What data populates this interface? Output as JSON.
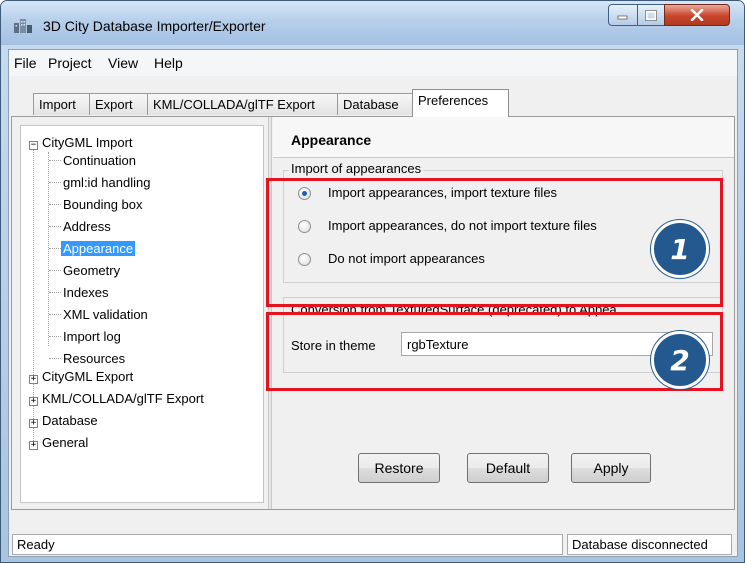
{
  "window": {
    "title": "3D City Database Importer/Exporter",
    "controls": [
      "minimize-icon",
      "maximize-icon",
      "close-icon"
    ]
  },
  "menu": [
    "File",
    "Project",
    "View",
    "Help"
  ],
  "tabs": [
    "Import",
    "Export",
    "KML/COLLADA/glTF Export",
    "Database",
    "Preferences"
  ],
  "active_tab": "Preferences",
  "tree": {
    "root_items": [
      "CityGML Import",
      "CityGML Export",
      "KML/COLLADA/glTF Export",
      "Database",
      "General"
    ],
    "citygml_import_children": [
      "Continuation",
      "gml:id handling",
      "Bounding box",
      "Address",
      "Appearance",
      "Geometry",
      "Indexes",
      "XML validation",
      "Import log",
      "Resources"
    ],
    "selected": "Appearance",
    "expander_expanded": "−",
    "expander_collapsed": "+"
  },
  "panel": {
    "title": "Appearance",
    "import_group": {
      "title": "Import of appearances",
      "options": [
        {
          "label": "Import appearances, import texture files",
          "checked": true
        },
        {
          "label": "Import appearances, do not import texture files",
          "checked": false
        },
        {
          "label": "Do not import appearances",
          "checked": false
        }
      ]
    },
    "conversion_group": {
      "title": "Conversion from TexturedSurface (deprecated) to Appea",
      "theme_label": "Store in theme",
      "theme_value": "rgbTexture"
    },
    "buttons": {
      "restore": "Restore",
      "default": "Default",
      "apply": "Apply"
    }
  },
  "annotations": {
    "badge1": "1",
    "badge2": "2",
    "highlight_color": "#e3141f",
    "badge_color": "#24598f"
  },
  "status": {
    "left": "Ready",
    "right": "Database disconnected"
  }
}
